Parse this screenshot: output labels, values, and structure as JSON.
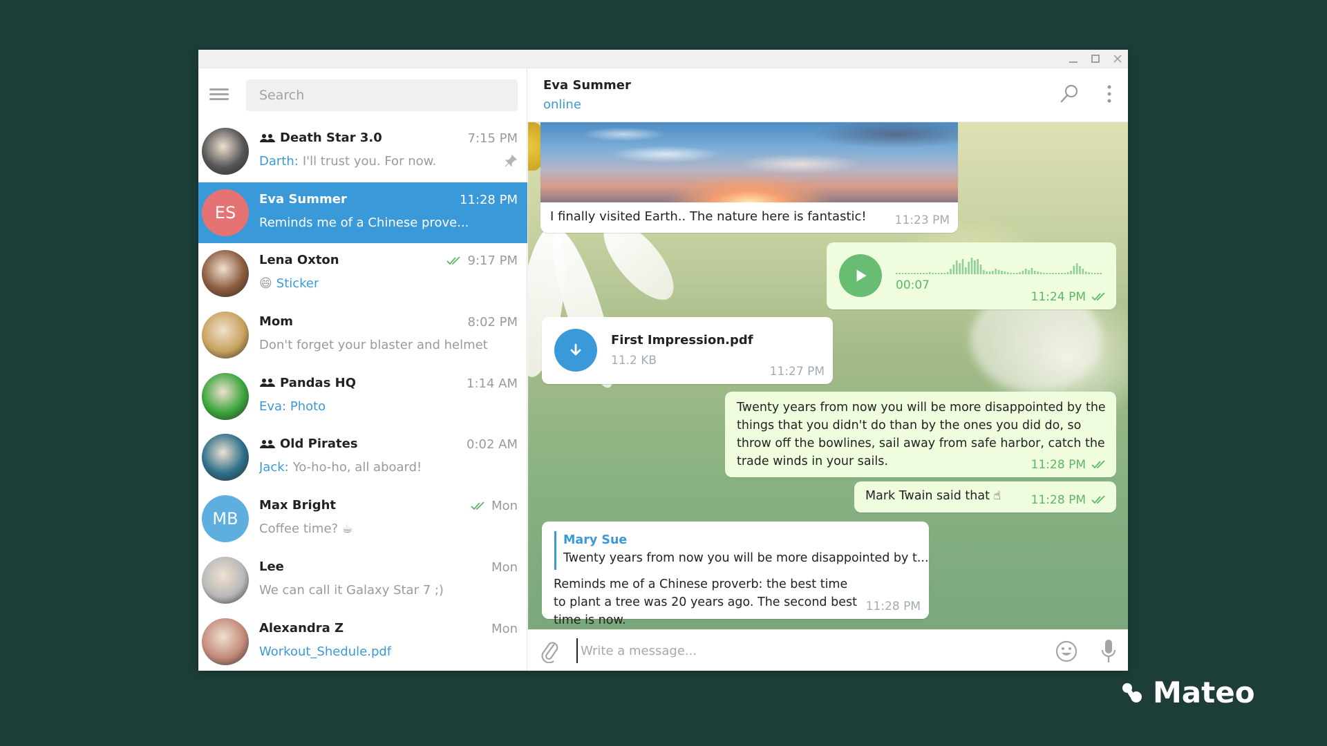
{
  "window": {
    "controls": [
      "minimize",
      "maximize",
      "close"
    ]
  },
  "sidebar": {
    "menu_icon": "hamburger-icon",
    "search": {
      "placeholder": "Search",
      "value": ""
    },
    "chats": [
      {
        "name": "Death Star 3.0",
        "group": true,
        "time": "7:15 PM",
        "sender": "Darth:",
        "preview": "I'll trust you. For now.",
        "pinned": true,
        "avatar_color": "#555555"
      },
      {
        "name": "Eva Summer",
        "group": false,
        "time": "11:28 PM",
        "sender": "",
        "preview": "Reminds me of a Chinese prove...",
        "selected": true,
        "initials": "ES",
        "avatar_color": "#e57373"
      },
      {
        "name": "Lena Oxton",
        "group": false,
        "time": "9:17 PM",
        "read": true,
        "sender": "",
        "preview_emoji": "😄",
        "preview": "Sticker",
        "preview_blue": true,
        "avatar_color": "#8a5a3c"
      },
      {
        "name": "Mom",
        "group": false,
        "time": "8:02 PM",
        "sender": "",
        "preview": "Don't forget your blaster and helmet",
        "avatar_color": "#c9a25e"
      },
      {
        "name": "Pandas HQ",
        "group": true,
        "time": "1:14 AM",
        "sender": "",
        "preview": "Eva: Photo",
        "preview_blue": true,
        "avatar_color": "#3aa53a"
      },
      {
        "name": "Old Pirates",
        "group": true,
        "time": "0:02 AM",
        "sender": "Jack:",
        "preview": "Yo-ho-ho, all aboard!",
        "avatar_color": "#2b6f8a"
      },
      {
        "name": "Max Bright",
        "group": false,
        "time": "Mon",
        "read": true,
        "sender": "",
        "preview": "Coffee time? ☕",
        "initials": "MB",
        "avatar_color": "#5eaee0"
      },
      {
        "name": "Lee",
        "group": false,
        "time": "Mon",
        "sender": "",
        "preview": "We can call it Galaxy Star 7 ;)",
        "avatar_color": "#b9b9b9"
      },
      {
        "name": "Alexandra Z",
        "group": false,
        "time": "Mon",
        "sender": "",
        "preview": "Workout_Shedule.pdf",
        "preview_blue": true,
        "avatar_color": "#c48a7a"
      }
    ]
  },
  "chat": {
    "peer_name": "Eva Summer",
    "peer_status": "online",
    "messages": {
      "photo": {
        "caption": "I finally visited Earth.. The nature here is fantastic!",
        "time": "11:23 PM"
      },
      "voice": {
        "duration": "00:07",
        "time": "11:24 PM",
        "read": true
      },
      "file": {
        "name": "First Impression.pdf",
        "size": "11.2 KB",
        "time": "11:27 PM"
      },
      "long": {
        "text": "Twenty years from now you will be more disappointed by the things that you didn't do than by the ones you did do, so throw off the bowlines, sail away from safe harbor, catch the trade winds in your sails.",
        "time": "11:28 PM",
        "read": true
      },
      "twain": {
        "text": "Mark Twain said that ☝",
        "time": "11:28 PM",
        "read": true
      },
      "reply": {
        "quote_author": "Mary Sue",
        "quote_text": "Twenty years from now you will be more disappointed by t...",
        "text": "Reminds me of a Chinese proverb: the best time to plant a tree was 20 years ago. The second best time is now.",
        "time": "11:28 PM"
      }
    },
    "input": {
      "placeholder": "Write a message...",
      "value": ""
    }
  },
  "colors": {
    "accent": "#3a9ad9",
    "outgoing_bubble": "#effdde",
    "outgoing_meta": "#5db665",
    "page_bg": "#1c3d38"
  },
  "brand": {
    "name": "Mateo"
  }
}
